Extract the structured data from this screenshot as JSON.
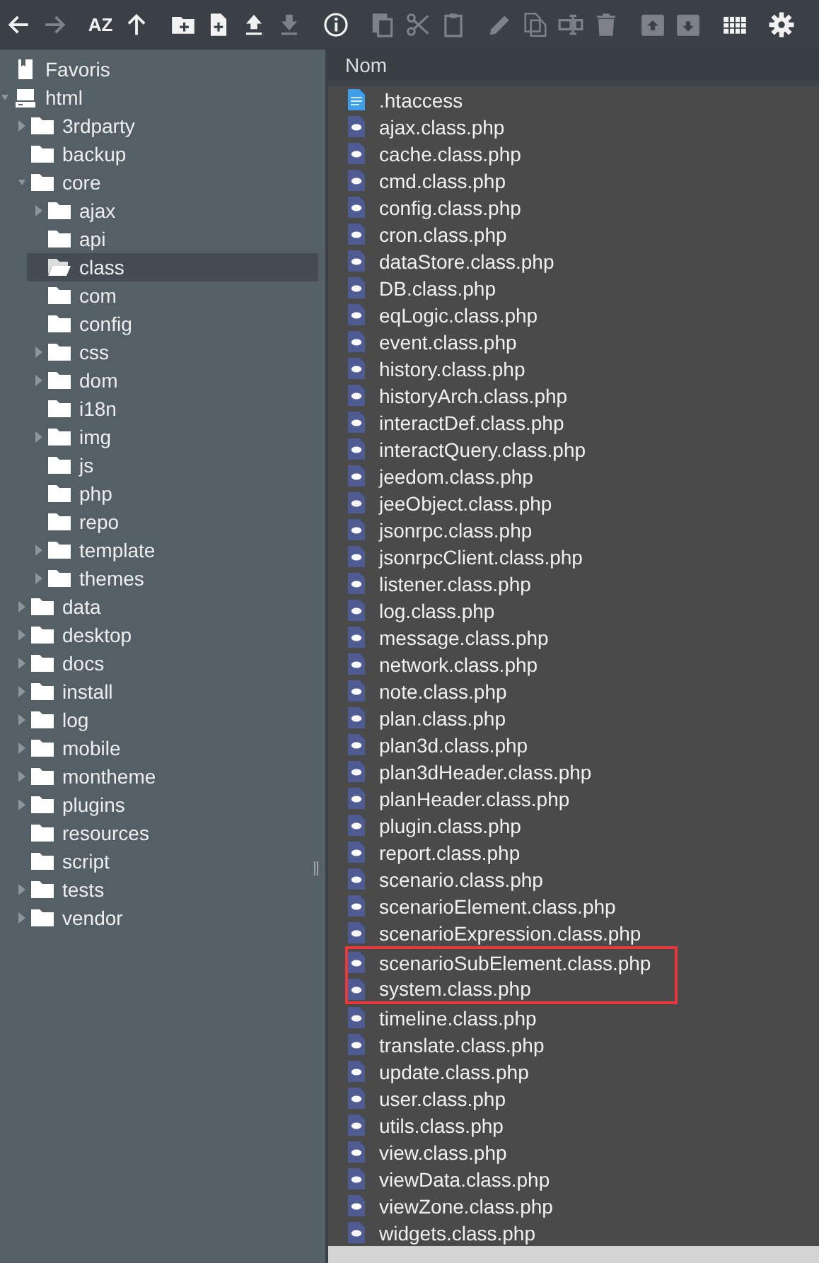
{
  "toolbar": {
    "groups": [
      [
        {
          "kind": "back",
          "disabled": false
        },
        {
          "kind": "forward",
          "disabled": true
        }
      ],
      [
        {
          "kind": "sort",
          "label": "AZ",
          "disabled": false
        },
        {
          "kind": "up",
          "disabled": false
        }
      ],
      [
        {
          "kind": "new-folder",
          "disabled": false
        },
        {
          "kind": "new-file",
          "disabled": false
        },
        {
          "kind": "upload",
          "disabled": false
        },
        {
          "kind": "download",
          "disabled": true
        }
      ],
      [
        {
          "kind": "info",
          "disabled": false
        }
      ],
      [
        {
          "kind": "copy",
          "disabled": true
        },
        {
          "kind": "cut",
          "disabled": true
        },
        {
          "kind": "paste",
          "disabled": true
        }
      ],
      [
        {
          "kind": "edit",
          "disabled": true
        },
        {
          "kind": "duplicate",
          "disabled": true
        },
        {
          "kind": "rename",
          "disabled": true
        },
        {
          "kind": "delete",
          "disabled": true
        }
      ],
      [
        {
          "kind": "archive",
          "disabled": true
        },
        {
          "kind": "extract",
          "disabled": true
        }
      ],
      [
        {
          "kind": "grid",
          "disabled": false
        }
      ],
      [
        {
          "kind": "settings",
          "disabled": false
        }
      ]
    ]
  },
  "tree": [
    {
      "label": "Favoris",
      "kind": "bookmark",
      "expandable": false,
      "expanded": false,
      "selected": false
    },
    {
      "label": "html",
      "kind": "drive",
      "expandable": true,
      "expanded": true,
      "selected": false,
      "children": [
        {
          "label": "3rdparty",
          "kind": "folder",
          "expandable": true,
          "expanded": false,
          "selected": false
        },
        {
          "label": "backup",
          "kind": "folder",
          "expandable": false,
          "expanded": false,
          "selected": false
        },
        {
          "label": "core",
          "kind": "folder",
          "expandable": true,
          "expanded": true,
          "selected": false,
          "children": [
            {
              "label": "ajax",
              "kind": "folder",
              "expandable": true,
              "expanded": false,
              "selected": false
            },
            {
              "label": "api",
              "kind": "folder",
              "expandable": false,
              "expanded": false,
              "selected": false
            },
            {
              "label": "class",
              "kind": "folder",
              "expandable": false,
              "expanded": false,
              "selected": true
            },
            {
              "label": "com",
              "kind": "folder",
              "expandable": false,
              "expanded": false,
              "selected": false
            },
            {
              "label": "config",
              "kind": "folder",
              "expandable": false,
              "expanded": false,
              "selected": false
            },
            {
              "label": "css",
              "kind": "folder",
              "expandable": true,
              "expanded": false,
              "selected": false
            },
            {
              "label": "dom",
              "kind": "folder",
              "expandable": true,
              "expanded": false,
              "selected": false
            },
            {
              "label": "i18n",
              "kind": "folder",
              "expandable": false,
              "expanded": false,
              "selected": false
            },
            {
              "label": "img",
              "kind": "folder",
              "expandable": true,
              "expanded": false,
              "selected": false
            },
            {
              "label": "js",
              "kind": "folder",
              "expandable": false,
              "expanded": false,
              "selected": false
            },
            {
              "label": "php",
              "kind": "folder",
              "expandable": false,
              "expanded": false,
              "selected": false
            },
            {
              "label": "repo",
              "kind": "folder",
              "expandable": false,
              "expanded": false,
              "selected": false
            },
            {
              "label": "template",
              "kind": "folder",
              "expandable": true,
              "expanded": false,
              "selected": false
            },
            {
              "label": "themes",
              "kind": "folder",
              "expandable": true,
              "expanded": false,
              "selected": false
            }
          ]
        },
        {
          "label": "data",
          "kind": "folder",
          "expandable": true,
          "expanded": false,
          "selected": false
        },
        {
          "label": "desktop",
          "kind": "folder",
          "expandable": true,
          "expanded": false,
          "selected": false
        },
        {
          "label": "docs",
          "kind": "folder",
          "expandable": true,
          "expanded": false,
          "selected": false
        },
        {
          "label": "install",
          "kind": "folder",
          "expandable": true,
          "expanded": false,
          "selected": false
        },
        {
          "label": "log",
          "kind": "folder",
          "expandable": true,
          "expanded": false,
          "selected": false
        },
        {
          "label": "mobile",
          "kind": "folder",
          "expandable": true,
          "expanded": false,
          "selected": false
        },
        {
          "label": "montheme",
          "kind": "folder",
          "expandable": true,
          "expanded": false,
          "selected": false
        },
        {
          "label": "plugins",
          "kind": "folder",
          "expandable": true,
          "expanded": false,
          "selected": false
        },
        {
          "label": "resources",
          "kind": "folder",
          "expandable": false,
          "expanded": false,
          "selected": false
        },
        {
          "label": "script",
          "kind": "folder",
          "expandable": false,
          "expanded": false,
          "selected": false
        },
        {
          "label": "tests",
          "kind": "folder",
          "expandable": true,
          "expanded": false,
          "selected": false
        },
        {
          "label": "vendor",
          "kind": "folder",
          "expandable": true,
          "expanded": false,
          "selected": false
        }
      ]
    }
  ],
  "file_list": {
    "columns": [
      "Nom"
    ],
    "rows": [
      {
        "name": ".htaccess",
        "kind": "text",
        "marked": false
      },
      {
        "name": "ajax.class.php",
        "kind": "php",
        "marked": false
      },
      {
        "name": "cache.class.php",
        "kind": "php",
        "marked": false
      },
      {
        "name": "cmd.class.php",
        "kind": "php",
        "marked": false
      },
      {
        "name": "config.class.php",
        "kind": "php",
        "marked": false
      },
      {
        "name": "cron.class.php",
        "kind": "php",
        "marked": false
      },
      {
        "name": "dataStore.class.php",
        "kind": "php",
        "marked": false
      },
      {
        "name": "DB.class.php",
        "kind": "php",
        "marked": false
      },
      {
        "name": "eqLogic.class.php",
        "kind": "php",
        "marked": false
      },
      {
        "name": "event.class.php",
        "kind": "php",
        "marked": false
      },
      {
        "name": "history.class.php",
        "kind": "php",
        "marked": false
      },
      {
        "name": "historyArch.class.php",
        "kind": "php",
        "marked": false
      },
      {
        "name": "interactDef.class.php",
        "kind": "php",
        "marked": false
      },
      {
        "name": "interactQuery.class.php",
        "kind": "php",
        "marked": false
      },
      {
        "name": "jeedom.class.php",
        "kind": "php",
        "marked": false
      },
      {
        "name": "jeeObject.class.php",
        "kind": "php",
        "marked": false
      },
      {
        "name": "jsonrpc.class.php",
        "kind": "php",
        "marked": false
      },
      {
        "name": "jsonrpcClient.class.php",
        "kind": "php",
        "marked": false
      },
      {
        "name": "listener.class.php",
        "kind": "php",
        "marked": false
      },
      {
        "name": "log.class.php",
        "kind": "php",
        "marked": false
      },
      {
        "name": "message.class.php",
        "kind": "php",
        "marked": false
      },
      {
        "name": "network.class.php",
        "kind": "php",
        "marked": false
      },
      {
        "name": "note.class.php",
        "kind": "php",
        "marked": false
      },
      {
        "name": "plan.class.php",
        "kind": "php",
        "marked": false
      },
      {
        "name": "plan3d.class.php",
        "kind": "php",
        "marked": false
      },
      {
        "name": "plan3dHeader.class.php",
        "kind": "php",
        "marked": false
      },
      {
        "name": "planHeader.class.php",
        "kind": "php",
        "marked": false
      },
      {
        "name": "plugin.class.php",
        "kind": "php",
        "marked": false
      },
      {
        "name": "report.class.php",
        "kind": "php",
        "marked": false
      },
      {
        "name": "scenario.class.php",
        "kind": "php",
        "marked": false
      },
      {
        "name": "scenarioElement.class.php",
        "kind": "php",
        "marked": false
      },
      {
        "name": "scenarioExpression.class.php",
        "kind": "php",
        "marked": false
      },
      {
        "name": "scenarioSubElement.class.php",
        "kind": "php",
        "marked": true
      },
      {
        "name": "system.class.php",
        "kind": "php",
        "marked": true
      },
      {
        "name": "timeline.class.php",
        "kind": "php",
        "marked": false
      },
      {
        "name": "translate.class.php",
        "kind": "php",
        "marked": false
      },
      {
        "name": "update.class.php",
        "kind": "php",
        "marked": false
      },
      {
        "name": "user.class.php",
        "kind": "php",
        "marked": false
      },
      {
        "name": "utils.class.php",
        "kind": "php",
        "marked": false
      },
      {
        "name": "view.class.php",
        "kind": "php",
        "marked": false
      },
      {
        "name": "viewData.class.php",
        "kind": "php",
        "marked": false
      },
      {
        "name": "viewZone.class.php",
        "kind": "php",
        "marked": false
      },
      {
        "name": "widgets.class.php",
        "kind": "php",
        "marked": false
      }
    ]
  }
}
